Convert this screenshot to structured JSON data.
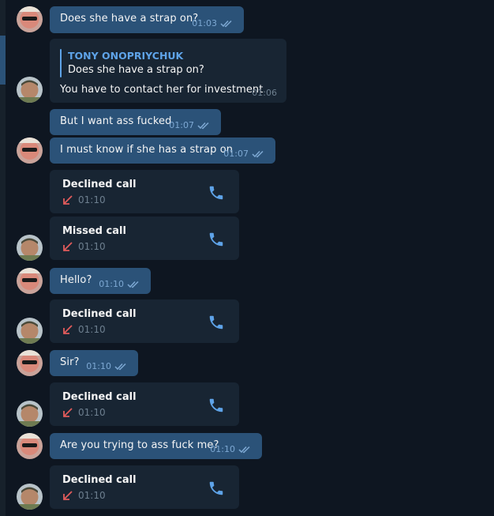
{
  "messages": [
    {
      "kind": "out",
      "text": "Does she have a strap on?",
      "time": "01:03"
    },
    {
      "kind": "in_reply",
      "reply_name": "TONY ONOPRIYCHUK",
      "reply_text": "Does she have a strap on?",
      "text": "You have to contact her for investment",
      "time": "01:06"
    },
    {
      "kind": "out",
      "text": "But I want ass fucked",
      "time": "01:07"
    },
    {
      "kind": "out",
      "text": "I must know if she has a strap on",
      "time": "01:07"
    },
    {
      "kind": "call",
      "title": "Declined call",
      "time": "01:10"
    },
    {
      "kind": "call",
      "title": "Missed call",
      "time": "01:10"
    },
    {
      "kind": "out",
      "text": "Hello?",
      "time": "01:10"
    },
    {
      "kind": "call",
      "title": "Declined call",
      "time": "01:10"
    },
    {
      "kind": "out",
      "text": "Sir?",
      "time": "01:10"
    },
    {
      "kind": "call",
      "title": "Declined call",
      "time": "01:10"
    },
    {
      "kind": "out",
      "text": "Are you trying to ass fuck me?",
      "time": "01:10"
    },
    {
      "kind": "call",
      "title": "Declined call",
      "time": "01:10"
    }
  ],
  "colors": {
    "background": "#0e1621",
    "outgoing_bubble": "#2b5278",
    "incoming_bubble": "#182533",
    "reply_accent": "#5ea3e8",
    "missed_arrow": "#e05b5b",
    "phone_icon": "#5ea3e8"
  },
  "icons": {
    "read_receipt": "double-check-icon",
    "call_direction": "arrow-down-left-icon",
    "call_button": "phone-icon"
  }
}
